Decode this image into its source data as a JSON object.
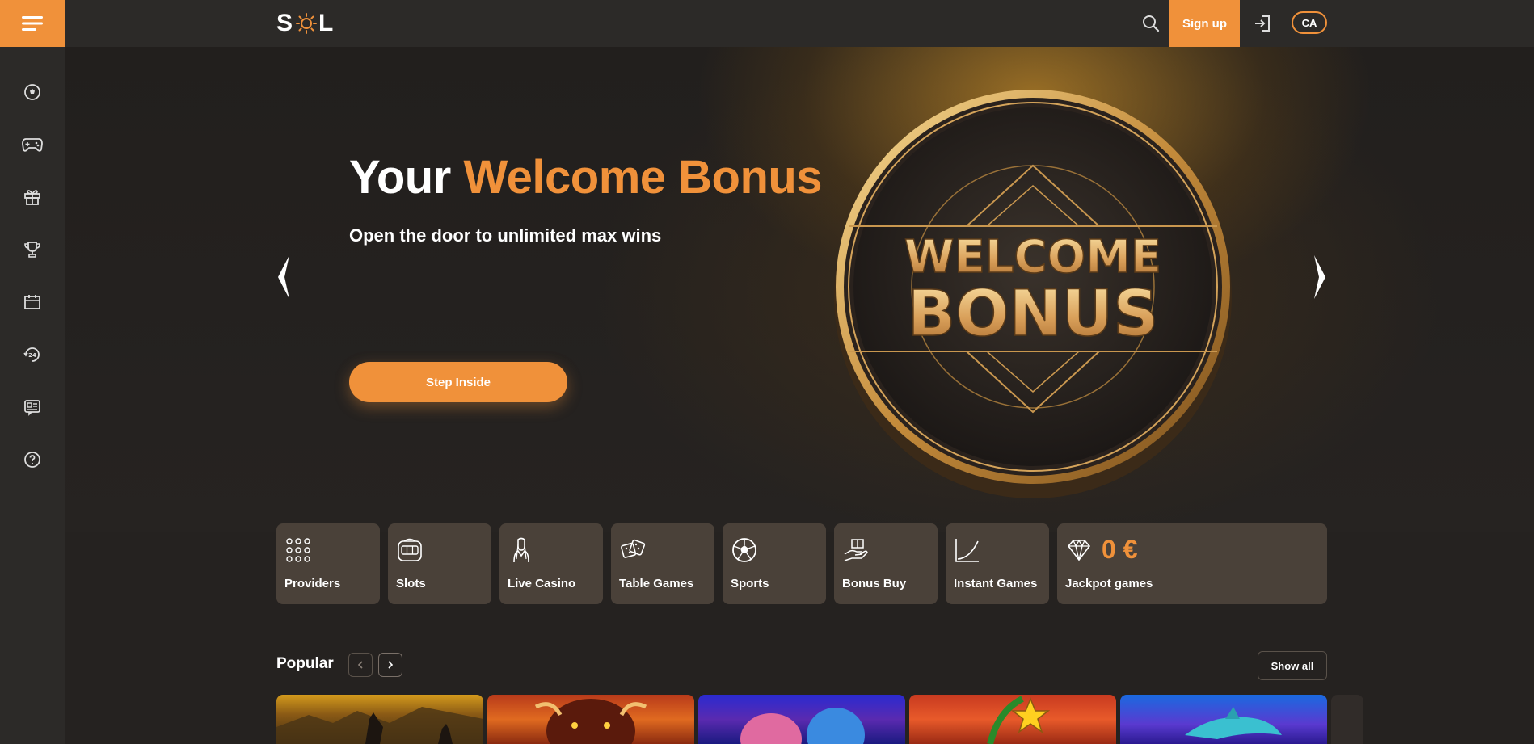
{
  "header": {
    "logo_text_left": "S",
    "logo_text_right": "L",
    "signup_label": "Sign up",
    "lang_label": "CA"
  },
  "sidebar": {
    "items": [
      "sports-icon",
      "gamepad-icon",
      "gift-icon",
      "trophy-icon",
      "calendar-icon",
      "support-24-icon",
      "news-icon",
      "help-icon"
    ]
  },
  "hero": {
    "title_white": "Your ",
    "title_accent": "Welcome Bonus",
    "subtitle": "Open the door to unlimited max wins",
    "cta_label": "Step Inside",
    "coin_line1": "WELCOME",
    "coin_line2": "BONUS"
  },
  "categories": [
    {
      "label": "Providers",
      "icon": "grid-dots-icon"
    },
    {
      "label": "Slots",
      "icon": "slot-machine-icon"
    },
    {
      "label": "Live Casino",
      "icon": "dealer-icon"
    },
    {
      "label": "Table Games",
      "icon": "dice-icon"
    },
    {
      "label": "Sports",
      "icon": "soccer-ball-icon"
    },
    {
      "label": "Bonus Buy",
      "icon": "hand-gift-icon"
    },
    {
      "label": "Instant Games",
      "icon": "curve-chart-icon"
    },
    {
      "label": "Jackpot games",
      "icon": "diamond-icon",
      "value": "0 €"
    }
  ],
  "popular": {
    "title": "Popular",
    "show_all_label": "Show all"
  },
  "colors": {
    "accent": "#f0913a",
    "background": "#252220",
    "panel": "#2c2a28",
    "category_bg": "#4a4139"
  }
}
